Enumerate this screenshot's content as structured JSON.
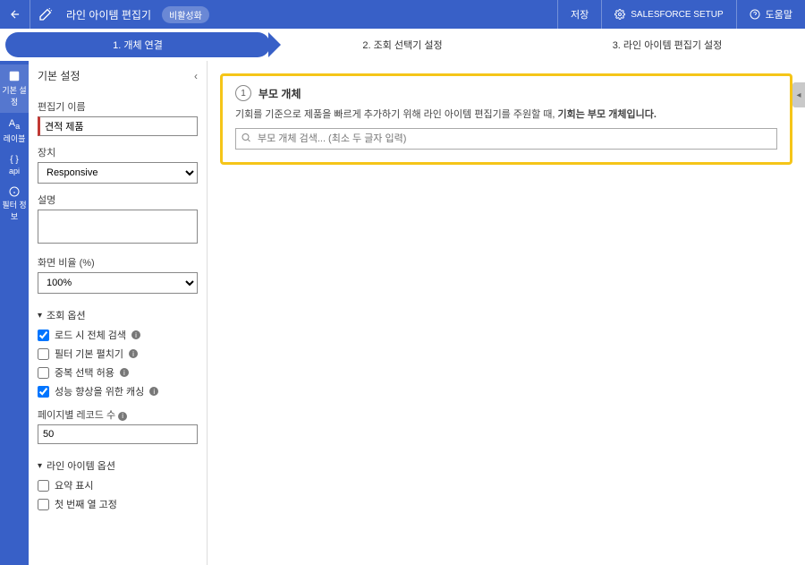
{
  "topbar": {
    "app_title": "라인 아이템 편집기",
    "badge": "비활성화",
    "save": "저장",
    "setup": "SALESFORCE SETUP",
    "help": "도움말"
  },
  "stepper": {
    "step1": "1. 개체 연결",
    "step2": "2. 조회 선택기 설정",
    "step3": "3. 라인 아이템 편집기 설정"
  },
  "rail": {
    "item0": "기본 설정",
    "item1": "레이블",
    "item2": "api",
    "item3": "필터 정보"
  },
  "sidebar": {
    "header": "기본 설정",
    "name_label": "편집기 이름",
    "name_value": "견적 제품",
    "device_label": "장치",
    "device_value": "Responsive",
    "desc_label": "설명",
    "desc_value": "",
    "ratio_label": "화면 비율 (%)",
    "ratio_value": "100%",
    "lookup_section": "조회 옵션",
    "opt_load_search": "로드 시 전체 검색",
    "opt_filter_expand": "필터 기본 펼치기",
    "opt_multi_select": "중복 선택 허용",
    "opt_caching": "성능 향상을 위한 캐싱",
    "records_label": "페이지별 레코드 수",
    "records_value": "50",
    "line_section": "라인 아이템 옵션",
    "opt_summary": "요약 표시",
    "opt_first_col": "첫 번째 열 고정"
  },
  "main": {
    "step_num": "1",
    "card_title": "부모 개체",
    "card_desc_a": "기회를 기준으로 제품을 빠르게 추가하기 위해 라인 아이템 편집기를 주원할 때, ",
    "card_desc_b": "기회는 부모 개체입니다.",
    "search_placeholder": "부모 개체 검색... (최소 두 글자 입력)"
  }
}
